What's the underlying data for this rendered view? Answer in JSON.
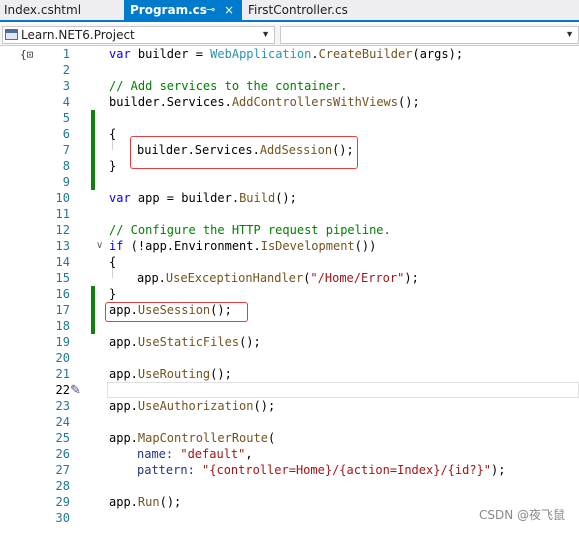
{
  "tabs": [
    {
      "label": "Index.cshtml",
      "active": false
    },
    {
      "label": "Program.cs",
      "active": true
    },
    {
      "label": "FirstController.cs",
      "active": false
    }
  ],
  "active_tab_pin": "⊸",
  "active_tab_close": "×",
  "navbar": {
    "project": "Learn.NET6.Project",
    "member": ""
  },
  "colors": {
    "accent": "#007acc",
    "keyword": "#0000ff",
    "comment": "#008000",
    "type": "#2b91af",
    "method": "#74531f",
    "string": "#a31515",
    "line_number": "#237893",
    "change_bar": "#108010",
    "highlight_box": "#e04040"
  },
  "icons": {
    "gutter": "{⊡",
    "quick_action": "pencil-icon"
  },
  "current_line": 22,
  "lines": [
    {
      "n": "1"
    },
    {
      "n": "2"
    },
    {
      "n": "3"
    },
    {
      "n": "4"
    },
    {
      "n": "5"
    },
    {
      "n": "6"
    },
    {
      "n": "7"
    },
    {
      "n": "8"
    },
    {
      "n": "9"
    },
    {
      "n": "10"
    },
    {
      "n": "11"
    },
    {
      "n": "12"
    },
    {
      "n": "13"
    },
    {
      "n": "14"
    },
    {
      "n": "15"
    },
    {
      "n": "16"
    },
    {
      "n": "17"
    },
    {
      "n": "18"
    },
    {
      "n": "19"
    },
    {
      "n": "20"
    },
    {
      "n": "21"
    },
    {
      "n": "22"
    },
    {
      "n": "23"
    },
    {
      "n": "24"
    },
    {
      "n": "25"
    },
    {
      "n": "26"
    },
    {
      "n": "27"
    },
    {
      "n": "28"
    },
    {
      "n": "29"
    },
    {
      "n": "30"
    }
  ],
  "code": {
    "l1": [
      "var",
      " builder = ",
      "WebApplication",
      ".",
      "CreateBuilder",
      "(args);"
    ],
    "l3": "// Add services to the container.",
    "l4": [
      "builder.Services.",
      "AddControllersWithViews",
      "();"
    ],
    "l6": "{",
    "l7": [
      "builder.Services.",
      "AddSession",
      "();"
    ],
    "l8": "}",
    "l10": [
      "var",
      " app = builder.",
      "Build",
      "();"
    ],
    "l12": "// Configure the HTTP request pipeline.",
    "l13": [
      "if",
      " (!app.Environment.",
      "IsDevelopment",
      "())"
    ],
    "l14": "{",
    "l15": [
      "app.",
      "UseExceptionHandler",
      "(",
      "\"/Home/Error\"",
      ");"
    ],
    "l16": "}",
    "l17": [
      "app.",
      "UseSession",
      "();"
    ],
    "l19": [
      "app.",
      "UseStaticFiles",
      "();"
    ],
    "l21": [
      "app.",
      "UseRouting",
      "();"
    ],
    "l23": [
      "app.",
      "UseAuthorization",
      "();"
    ],
    "l25": [
      "app.",
      "MapControllerRoute",
      "("
    ],
    "l26": [
      "name: ",
      "\"default\"",
      ","
    ],
    "l27": [
      "pattern: ",
      "\"{controller=Home}/{action=Index}/{id?}\"",
      ");"
    ],
    "l29": [
      "app.",
      "Run",
      "();"
    ]
  },
  "watermark": "CSDN @夜飞鼠"
}
